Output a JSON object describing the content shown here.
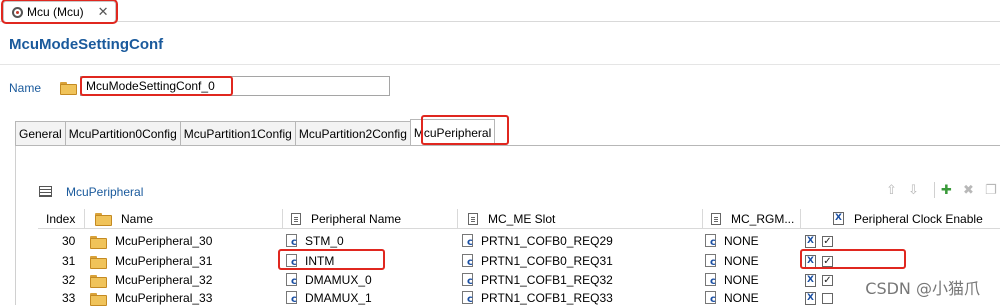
{
  "editor_tab": {
    "label": "Mcu (Mcu)",
    "close": "✕"
  },
  "form": {
    "title": "McuModeSettingConf",
    "name_label": "Name",
    "name_value": "McuModeSettingConf_0"
  },
  "tabs": [
    "General",
    "McuPartition0Config",
    "McuPartition1Config",
    "McuPartition2Config",
    "McuPeripheral"
  ],
  "section": {
    "label": "McuPeripheral"
  },
  "toolbar": {
    "up": "⇧",
    "down": "⇩",
    "add": "✚",
    "delete": "✖",
    "copy": "❐"
  },
  "table": {
    "headers": [
      "Index",
      "Name",
      "Peripheral Name",
      "MC_ME Slot",
      "MC_RGM...",
      "Peripheral Clock Enable"
    ],
    "rows": [
      {
        "index": "30",
        "name": "McuPeripheral_30",
        "peripheral": "STM_0",
        "slot": "PRTN1_COFB0_REQ29",
        "rgm": "NONE",
        "clock": true
      },
      {
        "index": "31",
        "name": "McuPeripheral_31",
        "peripheral": "INTM",
        "slot": "PRTN1_COFB0_REQ31",
        "rgm": "NONE",
        "clock": true
      },
      {
        "index": "32",
        "name": "McuPeripheral_32",
        "peripheral": "DMAMUX_0",
        "slot": "PRTN1_COFB1_REQ32",
        "rgm": "NONE",
        "clock": true
      },
      {
        "index": "33",
        "name": "McuPeripheral_33",
        "peripheral": "DMAMUX_1",
        "slot": "PRTN1_COFB1_REQ33",
        "rgm": "NONE",
        "clock": false
      }
    ]
  },
  "watermark": "CSDN @小猫爪",
  "colors": {
    "accent": "#1a5a9c",
    "highlight": "#e0271f"
  }
}
